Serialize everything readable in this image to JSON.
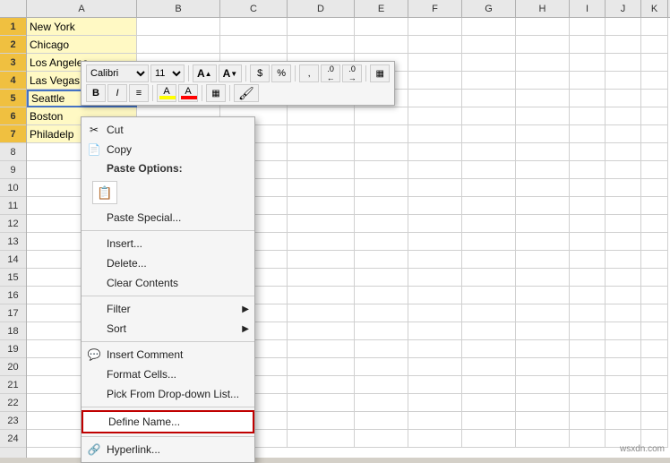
{
  "spreadsheet": {
    "columns": [
      "A",
      "B",
      "C",
      "D",
      "E",
      "F",
      "G",
      "H",
      "I",
      "J",
      "K"
    ],
    "rows": [
      {
        "num": 1,
        "a": "New York",
        "highlighted": true
      },
      {
        "num": 2,
        "a": "Chicago",
        "highlighted": true
      },
      {
        "num": 3,
        "a": "Los Angeles",
        "highlighted": true
      },
      {
        "num": 4,
        "a": "Las Vegas",
        "highlighted": true
      },
      {
        "num": 5,
        "a": "Seattle",
        "highlighted": true,
        "selected": true
      },
      {
        "num": 6,
        "a": "Boston",
        "highlighted": true
      },
      {
        "num": 7,
        "a": "Philadelp",
        "highlighted": true
      },
      {
        "num": 8,
        "a": ""
      },
      {
        "num": 9,
        "a": ""
      },
      {
        "num": 10,
        "a": ""
      },
      {
        "num": 11,
        "a": ""
      },
      {
        "num": 12,
        "a": ""
      },
      {
        "num": 13,
        "a": ""
      },
      {
        "num": 14,
        "a": ""
      },
      {
        "num": 15,
        "a": ""
      },
      {
        "num": 16,
        "a": ""
      },
      {
        "num": 17,
        "a": ""
      },
      {
        "num": 18,
        "a": ""
      },
      {
        "num": 19,
        "a": ""
      },
      {
        "num": 20,
        "a": ""
      },
      {
        "num": 21,
        "a": ""
      },
      {
        "num": 22,
        "a": ""
      },
      {
        "num": 23,
        "a": ""
      },
      {
        "num": 24,
        "a": ""
      }
    ]
  },
  "mini_toolbar": {
    "font": "Calibri",
    "font_size": "11",
    "bold_label": "B",
    "italic_label": "I",
    "align_label": "≡",
    "currency_label": "$",
    "percent_label": "%",
    "comma_label": ","
  },
  "context_menu": {
    "items": [
      {
        "id": "cut",
        "label": "Cut",
        "icon": "scissors",
        "has_icon": true
      },
      {
        "id": "copy",
        "label": "Copy",
        "icon": "copy",
        "has_icon": true
      },
      {
        "id": "paste-options-label",
        "label": "Paste Options:",
        "is_label": true
      },
      {
        "id": "paste-special",
        "label": "Paste Special...",
        "has_icon": false
      },
      {
        "id": "sep1",
        "separator": true
      },
      {
        "id": "insert",
        "label": "Insert...",
        "has_icon": false
      },
      {
        "id": "delete",
        "label": "Delete...",
        "has_icon": false
      },
      {
        "id": "clear-contents",
        "label": "Clear Contents",
        "has_icon": false
      },
      {
        "id": "sep2",
        "separator": true
      },
      {
        "id": "filter",
        "label": "Filter",
        "has_arrow": true,
        "has_icon": false
      },
      {
        "id": "sort",
        "label": "Sort",
        "has_arrow": true,
        "has_icon": false
      },
      {
        "id": "sep3",
        "separator": true
      },
      {
        "id": "insert-comment",
        "label": "Insert Comment",
        "has_icon": true,
        "icon": "comment"
      },
      {
        "id": "format-cells",
        "label": "Format Cells...",
        "has_icon": false
      },
      {
        "id": "pick-dropdown",
        "label": "Pick From Drop-down List...",
        "has_icon": false
      },
      {
        "id": "sep4",
        "separator": true
      },
      {
        "id": "define-name",
        "label": "Define Name...",
        "highlighted": true,
        "has_icon": false
      },
      {
        "id": "sep5",
        "separator": true
      },
      {
        "id": "hyperlink",
        "label": "Hyperlink...",
        "has_icon": true,
        "icon": "link"
      }
    ]
  },
  "watermark": "wsxdn.com"
}
